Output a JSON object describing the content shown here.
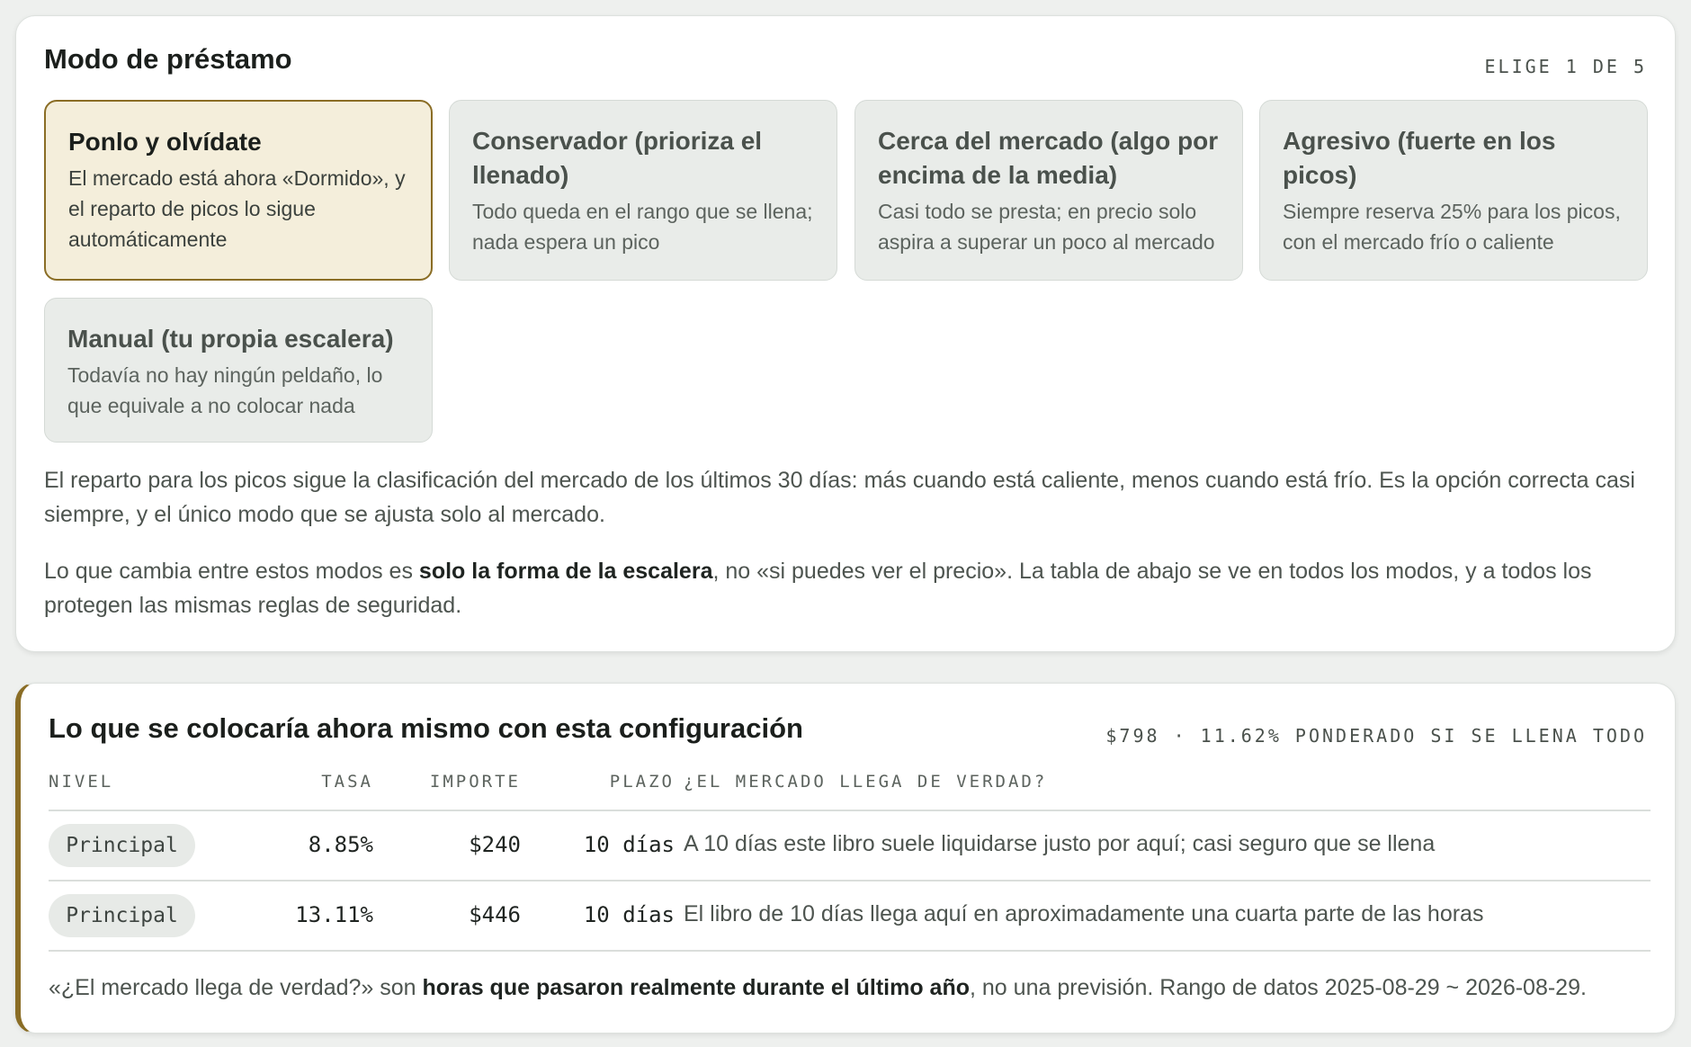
{
  "mode_card": {
    "title": "Modo de préstamo",
    "meta": "ELIGE 1 DE 5",
    "options": [
      {
        "title": "Ponlo y olvídate",
        "desc": "El mercado está ahora «Dormido», y el reparto de picos lo sigue automáticamente",
        "selected": true
      },
      {
        "title": "Conservador (prioriza el llenado)",
        "desc": "Todo queda en el rango que se llena; nada espera un pico",
        "selected": false
      },
      {
        "title": "Cerca del mercado (algo por encima de la media)",
        "desc": "Casi todo se presta; en precio solo aspira a superar un poco al mercado",
        "selected": false
      },
      {
        "title": "Agresivo (fuerte en los picos)",
        "desc": "Siempre reserva 25% para los picos, con el mercado frío o caliente",
        "selected": false
      },
      {
        "title": "Manual (tu propia escalera)",
        "desc": "Todavía no hay ningún peldaño, lo que equivale a no colocar nada",
        "selected": false
      }
    ],
    "explanation": "El reparto para los picos sigue la clasificación del mercado de los últimos 30 días: más cuando está caliente, menos cuando está frío. Es la opción correcta casi siempre, y el único modo que se ajusta solo al mercado.",
    "note_before": "Lo que cambia entre estos modos es ",
    "note_bold": "solo la forma de la escalera",
    "note_after": ", no «si puedes ver el precio». La tabla de abajo se ve en todos los modos, y a todos los protegen las mismas reglas de seguridad."
  },
  "preview_card": {
    "title": "Lo que se colocaría ahora mismo con esta configuración",
    "meta": "$798 · 11.62% PONDERADO SI SE LLENA TODO",
    "accent_color": "#8a6d25",
    "columns": {
      "level": "NIVEL",
      "rate": "TASA",
      "amount": "IMPORTE",
      "term": "PLAZO",
      "reach": "¿EL MERCADO LLEGA DE VERDAD?"
    },
    "rows": [
      {
        "level": "Principal",
        "rate": "8.85%",
        "amount": "$240",
        "term": "10 días",
        "reach": "A 10 días este libro suele liquidarse justo por aquí; casi seguro que se llena"
      },
      {
        "level": "Principal",
        "rate": "13.11%",
        "amount": "$446",
        "term": "10 días",
        "reach": "El libro de 10 días llega aquí en aproximadamente una cuarta parte de las horas"
      }
    ],
    "footnote_before": "«¿El mercado llega de verdad?» son ",
    "footnote_bold": "horas que pasaron realmente durante el último año",
    "footnote_after": ", no una previsión. Rango de datos 2025-08-29 ~ 2026-08-29."
  }
}
